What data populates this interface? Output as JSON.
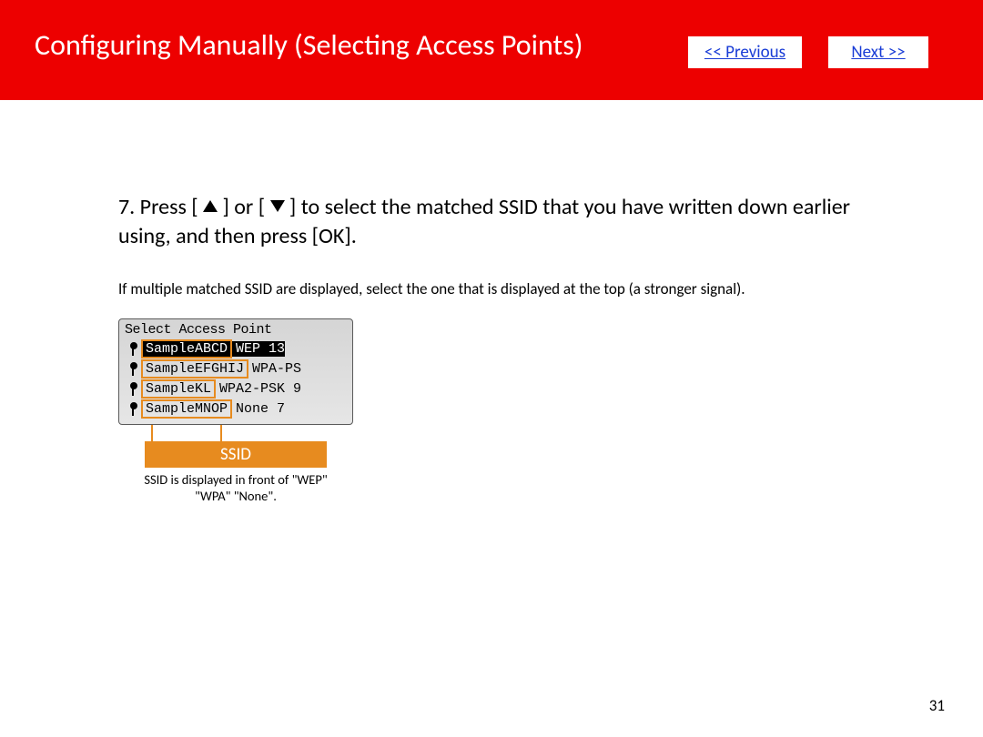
{
  "header": {
    "title": "Configuring Manually (Selecting Access Points)",
    "prev_label": "<< Previous",
    "next_label": "Next >>"
  },
  "instruction": {
    "step_num": "7.",
    "pre": "Press [  ",
    "mid": "  ] or [  ",
    "post": "  ] to select the matched SSID that you have written down earlier using, and then press [OK]."
  },
  "subnote": "If multiple matched SSID are displayed, select the one that is displayed at the top (a stronger signal).",
  "lcd": {
    "title": "Select Access Point",
    "rows": [
      {
        "ssid": "SampleABCD",
        "rest": "WEP 13",
        "selected": true
      },
      {
        "ssid": "SampleEFGHIJ",
        "rest": "WPA-PS",
        "selected": false
      },
      {
        "ssid": "SampleKL",
        "rest": "WPA2-PSK 9",
        "selected": false
      },
      {
        "ssid": "SampleMNOP",
        "rest": "None 7",
        "selected": false
      }
    ]
  },
  "callout": {
    "label": "SSID",
    "text": "SSID is displayed in front of \"WEP\" \"WPA\" \"None\"."
  },
  "page_number": "31"
}
